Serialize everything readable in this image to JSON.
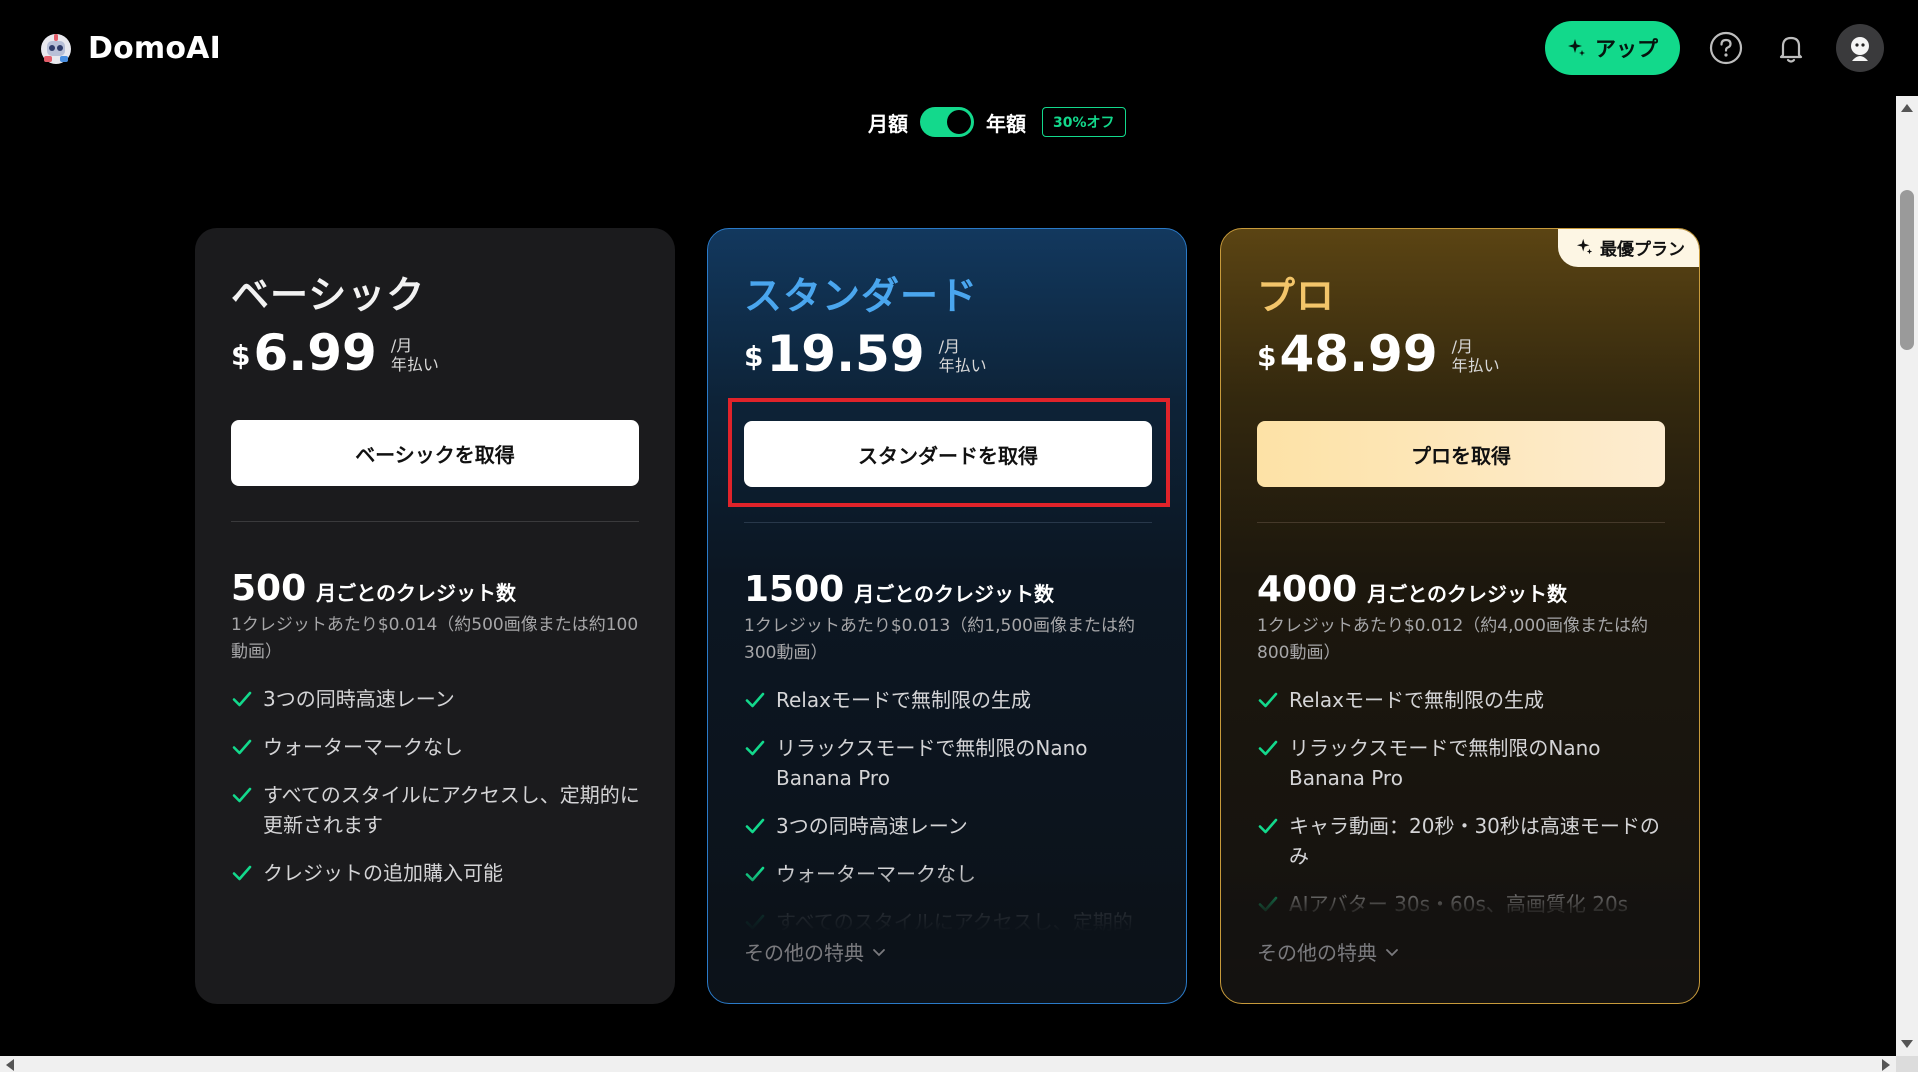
{
  "app": {
    "name": "DomoAI"
  },
  "header": {
    "upgrade_label": "アップ",
    "icons": [
      "sparkle-icon",
      "help-icon",
      "bell-icon",
      "avatar"
    ]
  },
  "billing": {
    "monthly_label": "月額",
    "yearly_label": "年額",
    "discount_badge": "30%オフ",
    "yearly_selected": true
  },
  "colors": {
    "accent_green": "#13d98c",
    "standard_accent": "#4aa6ee",
    "pro_accent": "#f3c56a",
    "highlight_red": "#e0232a"
  },
  "plans": [
    {
      "name": "ベーシック",
      "currency": "$",
      "price": "6.99",
      "per_month": "/月",
      "billing_note": "年払い",
      "cta": "ベーシックを取得",
      "credits": "500",
      "credits_unit": "月ごとのクレジット数",
      "credit_note": "1クレジットあたり$0.014（約500画像または約100動画）",
      "features": [
        "3つの同時高速レーン",
        "ウォーターマークなし",
        "すべてのスタイルにアクセスし、定期的に更新されます",
        "クレジットの追加購入可能"
      ]
    },
    {
      "name": "スタンダード",
      "currency": "$",
      "price": "19.59",
      "per_month": "/月",
      "billing_note": "年払い",
      "cta": "スタンダードを取得",
      "credits": "1500",
      "credits_unit": "月ごとのクレジット数",
      "credit_note": "1クレジットあたり$0.013（約1,500画像または約300動画）",
      "features": [
        "Relaxモードで無制限の生成",
        "リラックスモードで無制限のNano Banana Pro",
        "3つの同時高速レーン",
        "ウォーターマークなし",
        "すべてのスタイルにアクセスし、定期的"
      ],
      "more_label": "その他の特典"
    },
    {
      "name": "プロ",
      "badge": "最優プラン",
      "currency": "$",
      "price": "48.99",
      "per_month": "/月",
      "billing_note": "年払い",
      "cta": "プロを取得",
      "credits": "4000",
      "credits_unit": "月ごとのクレジット数",
      "credit_note": "1クレジットあたり$0.012（約4,000画像または約800動画）",
      "features": [
        "Relaxモードで無制限の生成",
        "リラックスモードで無制限のNano Banana Pro",
        "キャラ動画：20秒・30秒は高速モードのみ",
        "AIアバター 30s・60s、高画質化 20s"
      ],
      "more_label": "その他の特典"
    }
  ]
}
